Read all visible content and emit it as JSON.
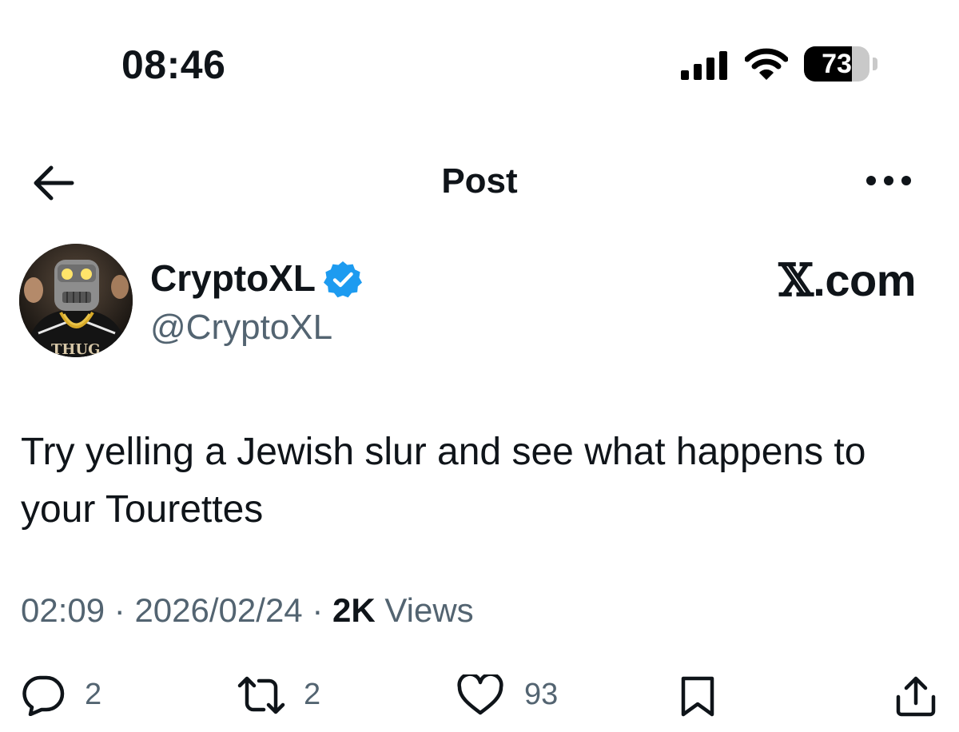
{
  "status_bar": {
    "time": "08:46",
    "battery_level": "73",
    "battery_fraction": 0.73,
    "icons": [
      "cellular-signal-icon",
      "wifi-icon",
      "battery-icon"
    ]
  },
  "header": {
    "title": "Post",
    "icons": [
      "back-arrow-icon",
      "more-options-icon"
    ]
  },
  "post": {
    "author": {
      "display_name": "CryptoXL",
      "handle": "@CryptoXL",
      "verified": true,
      "verified_color": "#1d9bf0",
      "avatar_text": "THUG"
    },
    "watermark": {
      "x_mark": "𝕏",
      "domain": ".com"
    },
    "text": "Try yelling a Jewish slur and see what happens to your Tourettes",
    "timestamp": "02:09",
    "date": "2026/02/24",
    "separator": "·",
    "views_count": "2K",
    "views_label": "Views"
  },
  "actions": {
    "replies": "2",
    "reposts": "2",
    "likes": "93",
    "icons": [
      "reply-icon",
      "repost-icon",
      "like-icon",
      "bookmark-icon",
      "share-icon"
    ]
  },
  "colors": {
    "text_primary": "#0f1419",
    "text_secondary": "#536471",
    "accent": "#1d9bf0"
  }
}
